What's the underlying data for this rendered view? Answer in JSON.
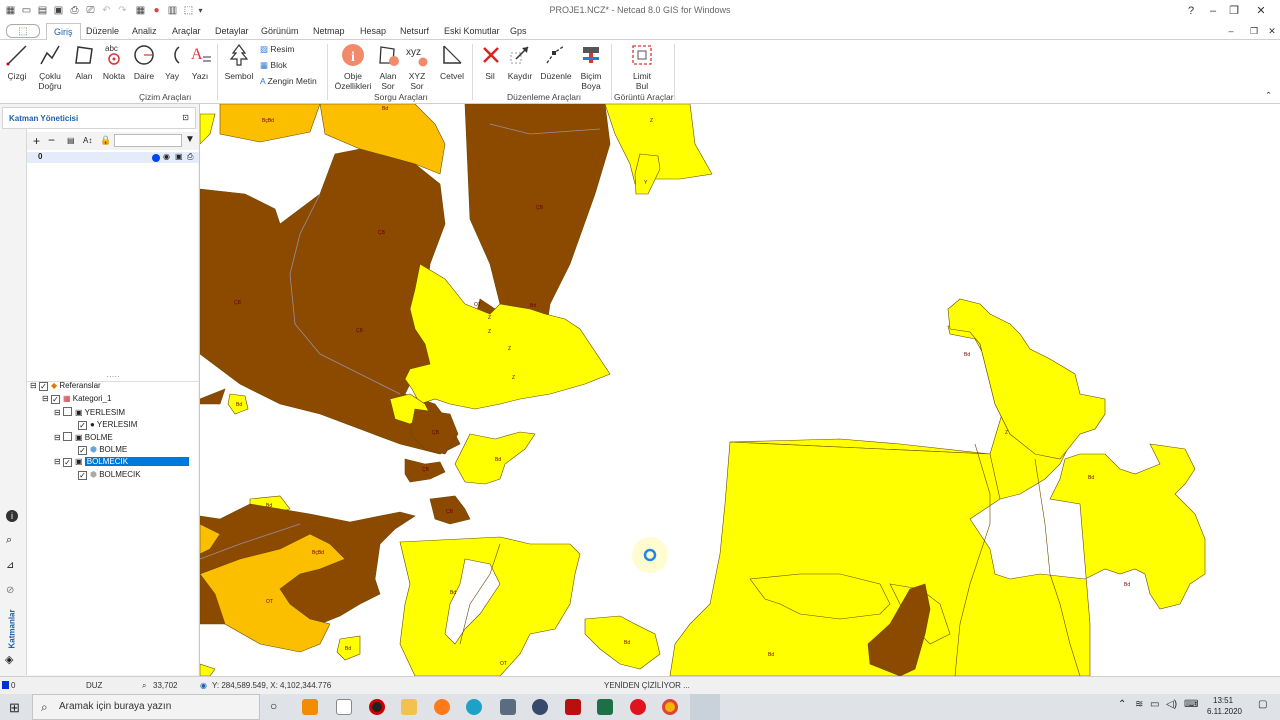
{
  "window": {
    "title": "PROJE1.NCZ* - Netcad 8.0 GIS for Windows",
    "controls": {
      "help": "?",
      "minimize": "–",
      "restore": "❐",
      "close": "✕"
    },
    "inner_controls": {
      "minimize": "–",
      "restore": "❐",
      "close": "✕"
    }
  },
  "menu_tabs": [
    "Giriş",
    "Düzenle",
    "Analiz",
    "Araçlar",
    "Detaylar",
    "Görünüm",
    "Netmap",
    "Hesap",
    "Netsurf",
    "Eski Komutlar",
    "Gps"
  ],
  "active_tab": "Giriş",
  "ribbon": {
    "drawing": {
      "buttons": [
        {
          "label1": "Çizgi",
          "label2": ""
        },
        {
          "label1": "Çoklu",
          "label2": "Doğru"
        },
        {
          "label1": "Alan",
          "label2": ""
        },
        {
          "label1": "Nokta",
          "label2": ""
        },
        {
          "label1": "Daire",
          "label2": ""
        },
        {
          "label1": "Yay",
          "label2": ""
        },
        {
          "label1": "Yazı",
          "label2": ""
        },
        {
          "label1": "Sembol",
          "label2": ""
        }
      ],
      "small": [
        "Resim",
        "Blok",
        "Zengin Metin"
      ],
      "group_label": "Çizim Araçları"
    },
    "query": {
      "buttons": [
        {
          "label1": "Obje",
          "label2": "Özellikleri"
        },
        {
          "label1": "Alan",
          "label2": "Sor"
        },
        {
          "label1": "XYZ",
          "label2": "Sor"
        },
        {
          "label1": "Cetvel",
          "label2": ""
        }
      ],
      "group_label": "Sorgu Araçları"
    },
    "edit": {
      "buttons": [
        {
          "label1": "Sil",
          "label2": ""
        },
        {
          "label1": "Kaydır",
          "label2": ""
        },
        {
          "label1": "Düzenle",
          "label2": ""
        },
        {
          "label1": "Biçim",
          "label2": "Boya"
        }
      ],
      "group_label": "Düzenleme Araçları"
    },
    "view": {
      "buttons": [
        {
          "label1": "Limit",
          "label2": "Bul"
        }
      ],
      "group_label": "Görüntü Araçları"
    }
  },
  "layer_manager": {
    "title": "Katman Yöneticisi",
    "layer_row": "0",
    "side_tab": "Katmanlar",
    "tree": {
      "referanslar": "Referanslar",
      "kategori": "Kategori_1",
      "yerlesim_group": "YERLESIM",
      "yerlesim_item": "YERLESIM",
      "bolme_group": "BOLME",
      "bolme_item": "BOLME",
      "bolmecik_group": "BOLMECIK",
      "bolmecik_item": "BOLMECIK"
    }
  },
  "map": {
    "labels": {
      "yellow": [
        "Z",
        "Y",
        "Z",
        "OT",
        "Bd",
        "Z",
        "Z",
        "Z",
        "Bd",
        "Bd",
        "Bd",
        "Bd",
        "OT",
        "Bd",
        "Bd",
        "Bd",
        "Z",
        "Bd"
      ],
      "brown": [
        "ÇB",
        "ÇB",
        "ÇB",
        "ÇB",
        "ÇB",
        "ÇB",
        "BçBd",
        "ÇB"
      ],
      "orange": [
        "BçBd",
        "Bd",
        "OT",
        "Bd"
      ]
    },
    "colors": {
      "yellow": "#ffff00",
      "brown": "#8b4a00",
      "orange": "#fbbf00",
      "white": "#ffffff"
    }
  },
  "status": {
    "color_index": "0",
    "mode": "DUZ",
    "zoom": "33,702",
    "coords": "Y: 284,589.549, X: 4,102,344.776",
    "message": "YENİDEN ÇİZİLİYOR ..."
  },
  "taskbar": {
    "search_placeholder": "Aramak için buraya yazın",
    "time": "13:51",
    "date": "6.11.2020"
  }
}
